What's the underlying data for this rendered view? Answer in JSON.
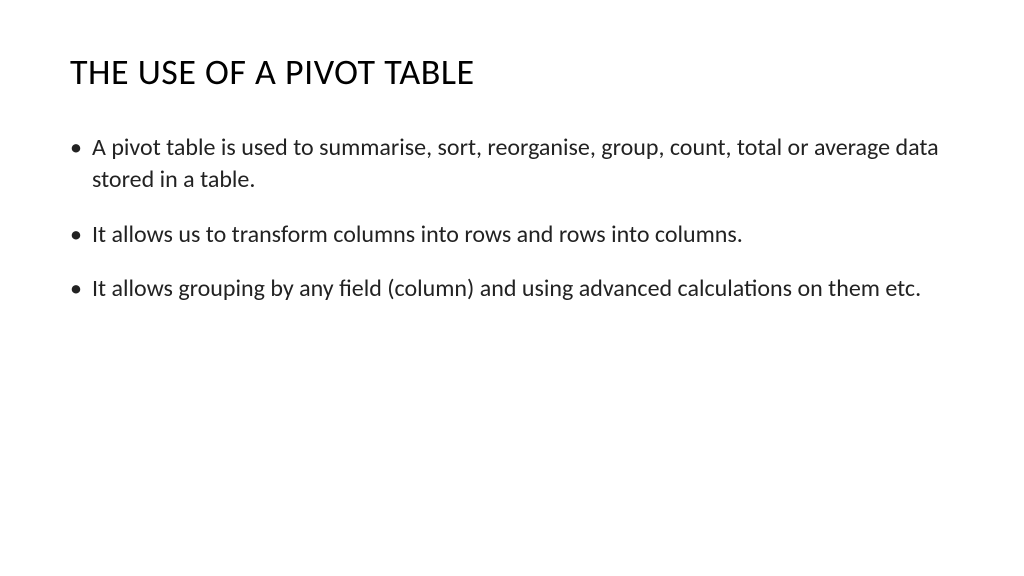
{
  "slide": {
    "title": "THE USE OF A PIVOT TABLE",
    "bullets": [
      "A pivot table is used to summarise, sort, reorganise, group, count, total or average data stored in a table.",
      "It allows us to transform columns into rows and rows into columns.",
      "It allows grouping by any field (column) and using advanced calculations on them etc."
    ]
  }
}
